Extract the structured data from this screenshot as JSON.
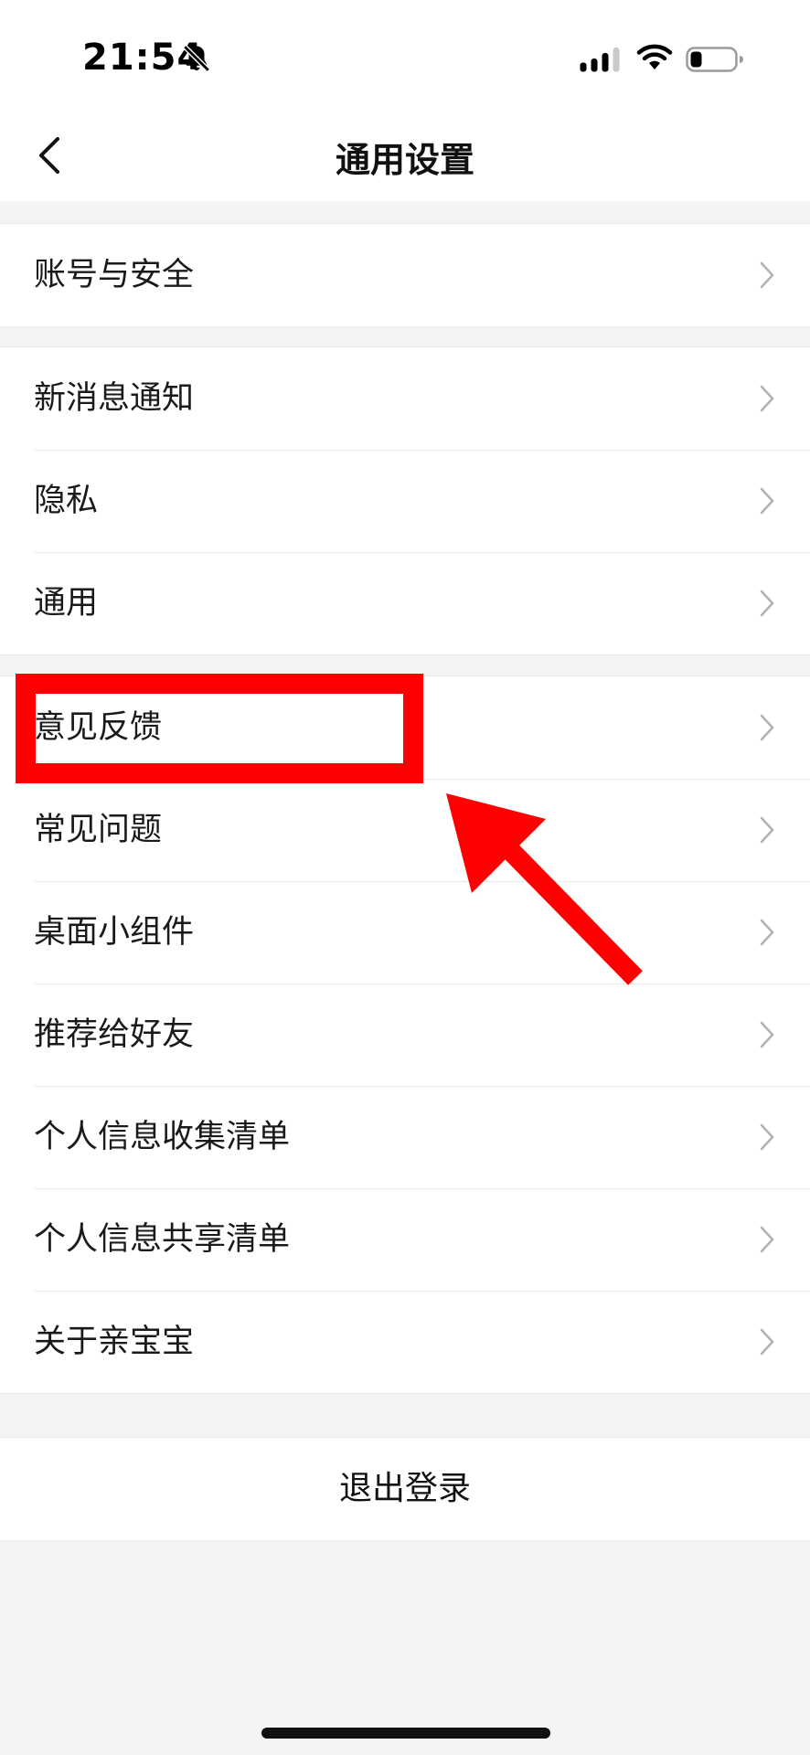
{
  "status_bar": {
    "time": "21:54",
    "icons": [
      "bell-off-icon",
      "signal-icon",
      "wifi-icon",
      "battery-icon"
    ]
  },
  "nav": {
    "title": "通用设置",
    "back_icon": "chevron-left-icon"
  },
  "groups": [
    {
      "items": [
        {
          "label": "账号与安全"
        }
      ]
    },
    {
      "items": [
        {
          "label": "新消息通知"
        },
        {
          "label": "隐私"
        },
        {
          "label": "通用"
        }
      ]
    },
    {
      "items": [
        {
          "label": "意见反馈"
        },
        {
          "label": "常见问题"
        },
        {
          "label": "桌面小组件"
        },
        {
          "label": "推荐给好友"
        },
        {
          "label": "个人信息收集清单"
        },
        {
          "label": "个人信息共享清单"
        },
        {
          "label": "关于亲宝宝"
        }
      ]
    }
  ],
  "logout": {
    "label": "退出登录"
  },
  "annotation": {
    "color": "#ff0000",
    "highlighted_item": "意见反馈",
    "shapes": [
      "highlight-box",
      "arrow-icon"
    ]
  },
  "colors": {
    "background": "#f4f4f4",
    "surface": "#ffffff",
    "text": "#1a1a1a",
    "chevron": "#b3b3b3"
  }
}
